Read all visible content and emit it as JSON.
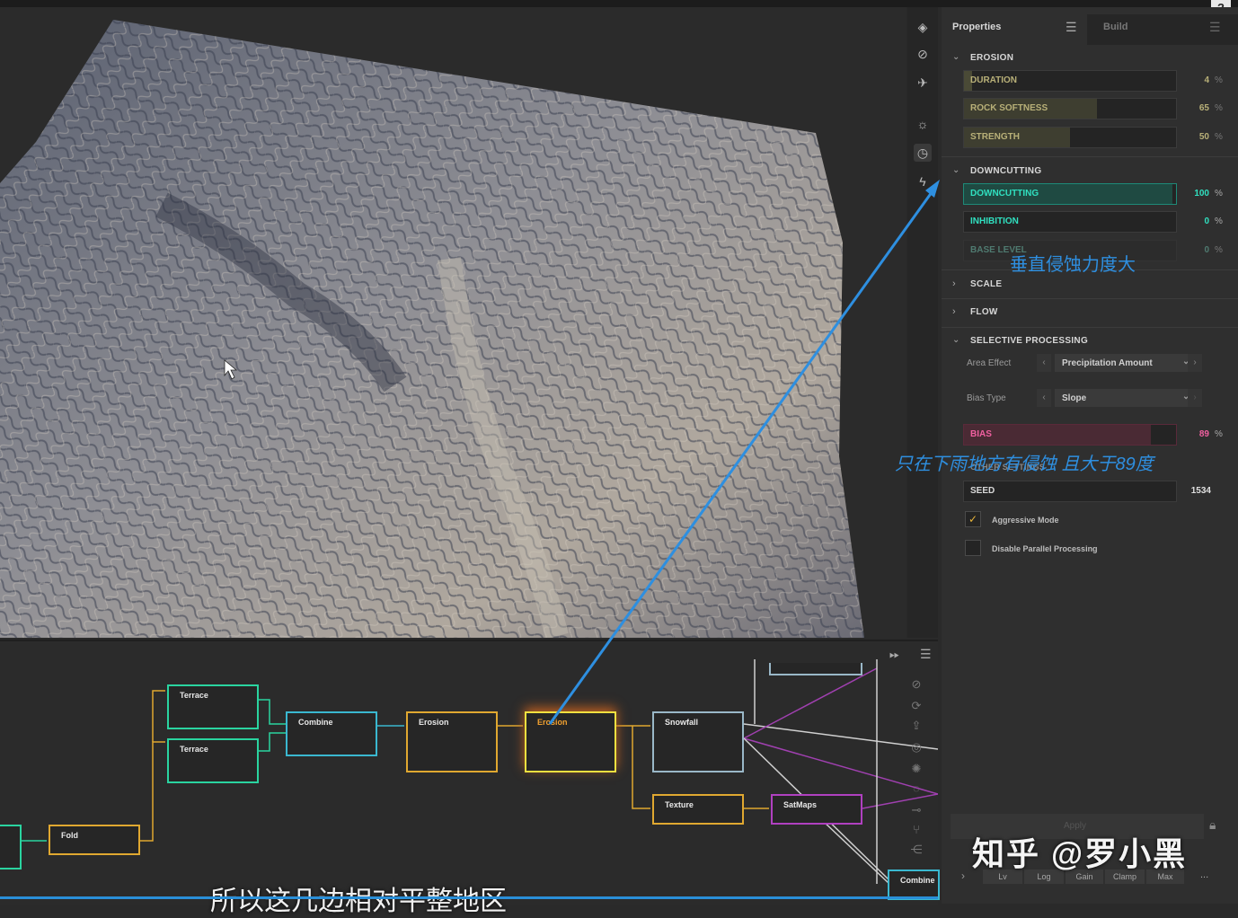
{
  "help": "?",
  "tabs": {
    "properties": "Properties",
    "build": "Build"
  },
  "erosion": {
    "title": "EROSION",
    "sliders": [
      {
        "label": "DURATION",
        "value": "4",
        "fraction": 0.04
      },
      {
        "label": "ROCK SOFTNESS",
        "value": "65",
        "fraction": 0.65
      },
      {
        "label": "STRENGTH",
        "value": "50",
        "fraction": 0.5
      }
    ]
  },
  "downcutting": {
    "title": "DOWNCUTTING",
    "sliders": [
      {
        "label": "DOWNCUTTING",
        "value": "100",
        "fraction": 1.0
      },
      {
        "label": "INHIBITION",
        "value": "0",
        "fraction": 0.0
      },
      {
        "label": "BASE LEVEL",
        "value": "0",
        "fraction": 0.0
      }
    ]
  },
  "scale": {
    "title": "SCALE"
  },
  "flow": {
    "title": "FLOW"
  },
  "selective": {
    "title": "SELECTIVE PROCESSING",
    "area_effect_label": "Area Effect",
    "area_effect_value": "Precipitation Amount",
    "bias_type_label": "Bias Type",
    "bias_type_value": "Slope",
    "bias": {
      "label": "BIAS",
      "value": "89",
      "fraction": 0.89
    }
  },
  "other": {
    "title": "OTHER SETTINGS",
    "seed_label": "SEED",
    "seed_value": "1534",
    "aggressive_mode": "Aggressive Mode",
    "aggressive_checked": true,
    "disable_parallel": "Disable Parallel Processing",
    "disable_parallel_checked": false
  },
  "percent": "%",
  "apply": "Apply",
  "bottom_buttons": [
    "Lv",
    "Log",
    "Gain",
    "Clamp",
    "Max"
  ],
  "more": "...",
  "nodes": {
    "terrace1": "Terrace",
    "terrace2": "Terrace",
    "combine1": "Combine",
    "erosion1": "Erosion",
    "erosion2": "Erosion",
    "snowfall": "Snowfall",
    "fold": "Fold",
    "texture": "Texture",
    "satmaps": "SatMaps",
    "combine2": "Combine"
  },
  "annotations": {
    "downcutting_note": "垂直侵蚀力度大",
    "bias_note": "只在下雨地方有侵蚀   且大于89度"
  },
  "watermark": "知乎 @罗小黑",
  "subtitle": "所以这几边相对平整地区",
  "colors": {
    "erosion_accent": "#8a8a4a",
    "downcutting_accent": "#20d0b0",
    "bias_accent": "#e05080",
    "terrace": "#2ad4a0",
    "combine": "#3ab8d0",
    "erosion_node": "#e0a830",
    "erosion_selected": "#f0e040",
    "snowfall": "#9ab8c8",
    "satmaps": "#b040c0",
    "annotation": "#2e8fe0"
  }
}
